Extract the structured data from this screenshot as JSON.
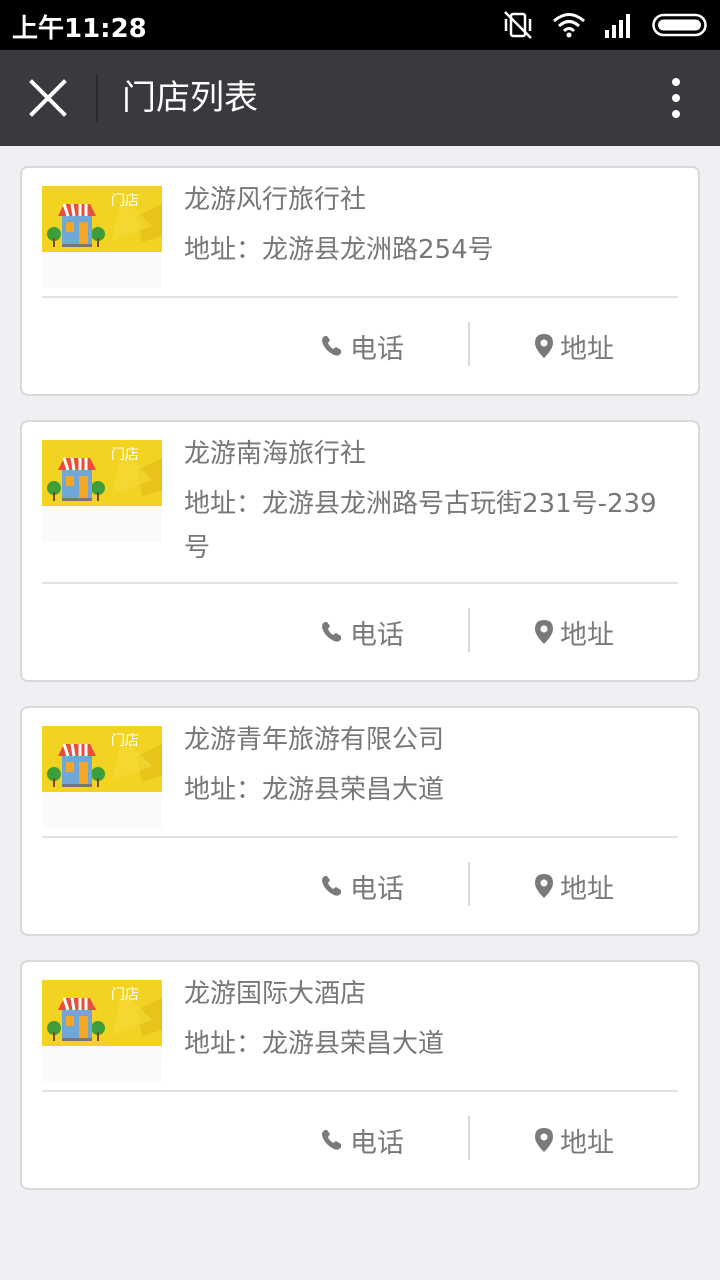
{
  "status_bar": {
    "time": "上午11:28"
  },
  "header": {
    "title": "门店列表"
  },
  "stores": [
    {
      "name": "龙游风行旅行社",
      "address": "地址：龙游县龙洲路254号",
      "phone_label": "电话",
      "address_label": "地址",
      "thumb_text": "门店"
    },
    {
      "name": "龙游南海旅行社",
      "address": "地址：龙游县龙洲路号古玩街231号-239号",
      "phone_label": "电话",
      "address_label": "地址",
      "thumb_text": "门店"
    },
    {
      "name": "龙游青年旅游有限公司",
      "address": "地址：龙游县荣昌大道",
      "phone_label": "电话",
      "address_label": "地址",
      "thumb_text": "门店"
    },
    {
      "name": "龙游国际大酒店",
      "address": "地址：龙游县荣昌大道",
      "phone_label": "电话",
      "address_label": "地址",
      "thumb_text": "门店"
    }
  ],
  "colors": {
    "title_bar": "#393a3f",
    "background": "#efeff4",
    "thumb_yellow": "#f2d321"
  }
}
